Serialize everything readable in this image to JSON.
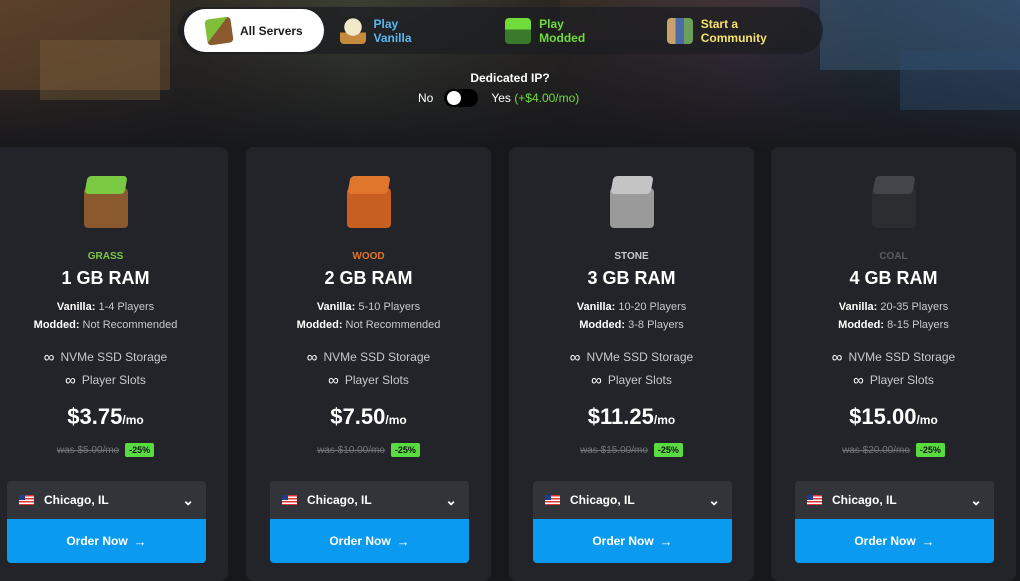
{
  "nav": {
    "items": [
      {
        "label": "All Servers",
        "icon": "grass-block-icon",
        "color": "#1b1c20"
      },
      {
        "label": "Play Vanilla",
        "icon": "ice-cream-icon",
        "color": "#56b8f3"
      },
      {
        "label": "Play Modded",
        "icon": "modded-block-icon",
        "color": "#6fdc3c"
      },
      {
        "label": "Start a Community",
        "icon": "players-icon",
        "color": "#f5e26a"
      }
    ]
  },
  "dedicated_ip": {
    "title": "Dedicated IP?",
    "no_label": "No",
    "yes_label": "Yes",
    "yes_price": "(+$4.00/mo)",
    "enabled": false
  },
  "plans": [
    {
      "tier": "GRASS",
      "tier_color": "#7ac943",
      "ram": "1 GB RAM",
      "vanilla_label": "Vanilla:",
      "vanilla": "1-4 Players",
      "modded_label": "Modded:",
      "modded": "Not Recommended",
      "storage": "NVMe SSD Storage",
      "slots": "Player Slots",
      "infinity": "∞",
      "price": "$3.75",
      "per": "/mo",
      "was": "was $5.00/mo",
      "discount": "-25%",
      "location": "Chicago, IL",
      "order": "Order Now",
      "arrow": "→",
      "chevron": "⌄"
    },
    {
      "tier": "WOOD",
      "tier_color": "#e0762b",
      "ram": "2 GB RAM",
      "vanilla_label": "Vanilla:",
      "vanilla": "5-10 Players",
      "modded_label": "Modded:",
      "modded": "Not Recommended",
      "storage": "NVMe SSD Storage",
      "slots": "Player Slots",
      "infinity": "∞",
      "price": "$7.50",
      "per": "/mo",
      "was": "was $10.00/mo",
      "discount": "-25%",
      "location": "Chicago, IL",
      "order": "Order Now",
      "arrow": "→",
      "chevron": "⌄"
    },
    {
      "tier": "STONE",
      "tier_color": "#c8c9cc",
      "ram": "3 GB RAM",
      "vanilla_label": "Vanilla:",
      "vanilla": "10-20 Players",
      "modded_label": "Modded:",
      "modded": "3-8 Players",
      "storage": "NVMe SSD Storage",
      "slots": "Player Slots",
      "infinity": "∞",
      "price": "$11.25",
      "per": "/mo",
      "was": "was $15.00/mo",
      "discount": "-25%",
      "location": "Chicago, IL",
      "order": "Order Now",
      "arrow": "→",
      "chevron": "⌄"
    },
    {
      "tier": "COAL",
      "tier_color": "#5a5b60",
      "ram": "4 GB RAM",
      "vanilla_label": "Vanilla:",
      "vanilla": "20-35 Players",
      "modded_label": "Modded:",
      "modded": "8-15 Players",
      "storage": "NVMe SSD Storage",
      "slots": "Player Slots",
      "infinity": "∞",
      "price": "$15.00",
      "per": "/mo",
      "was": "was $20.00/mo",
      "discount": "-25%",
      "location": "Chicago, IL",
      "order": "Order Now",
      "arrow": "→",
      "chevron": "⌄"
    }
  ],
  "colors": {
    "accent": "#0a9af0",
    "discount": "#59dc3f",
    "card": "#232429",
    "background": "#17181c"
  }
}
